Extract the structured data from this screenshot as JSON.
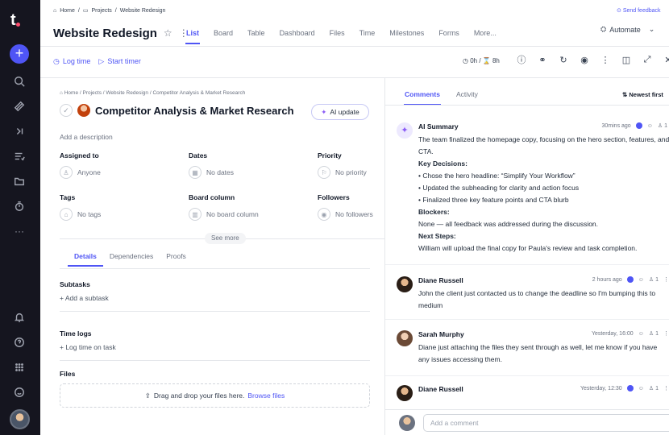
{
  "top": {
    "breadcrumb": [
      "Home",
      "Projects",
      "Website Redesign"
    ],
    "feedback": "Send feedback"
  },
  "project": {
    "title": "Website Redesign",
    "views": [
      "List",
      "Board",
      "Table",
      "Dashboard",
      "Files",
      "Time",
      "Milestones",
      "Forms",
      "More..."
    ],
    "active_view": "List",
    "automate": "Automate"
  },
  "toolbar": {
    "log_time": "Log time",
    "start_timer": "Start timer",
    "timer_status": "0h / ⌛ 8h"
  },
  "task": {
    "breadcrumb": "Home / Projects / Website Redesign / Competitor Analysis & Market Research",
    "title": "Competitor Analysis & Market Research",
    "ai_update": "AI update",
    "add_description": "Add a description",
    "fields": {
      "assigned_label": "Assigned to",
      "assigned_value": "Anyone",
      "dates_label": "Dates",
      "dates_value": "No dates",
      "priority_label": "Priority",
      "priority_value": "No priority",
      "tags_label": "Tags",
      "tags_value": "No tags",
      "column_label": "Board column",
      "column_value": "No board column",
      "followers_label": "Followers",
      "followers_value": "No followers"
    },
    "see_more": "See more",
    "tabs": [
      "Details",
      "Dependencies",
      "Proofs"
    ],
    "active_tab": "Details",
    "subtasks_title": "Subtasks",
    "add_subtask": "Add a subtask",
    "timelogs_title": "Time logs",
    "log_time_on_task": "Log time on task",
    "files_title": "Files",
    "drop_text": "Drag and drop your files here.",
    "browse": "Browse files"
  },
  "comments_panel": {
    "tabs": [
      "Comments",
      "Activity"
    ],
    "sort": "Newest first",
    "ai_summary": {
      "name": "AI Summary",
      "time": "30mins ago",
      "count": "1",
      "intro": "The team finalized the homepage copy, focusing on the hero section, features, and CTA.",
      "decisions_title": "Key Decisions:",
      "decisions": [
        "• Chose the hero headline: “Simplify Your Workflow”",
        "• Updated the subheading for clarity and action focus",
        "• Finalized three key feature points and CTA blurb"
      ],
      "blockers_title": "Blockers:",
      "blockers": "None — all feedback was addressed during the discussion.",
      "next_title": "Next Steps:",
      "next": "William will upload the final copy for Paula's review and task completion."
    },
    "comments": [
      {
        "name": "Diane Russell",
        "time": "2 hours ago",
        "count": "1",
        "text": "John the client just contacted us to change the deadline so I'm bumping this to medium"
      },
      {
        "name": "Sarah Murphy",
        "time": "Yesterday, 16:00",
        "count": "1",
        "text": "Diane just attaching the files they sent through as well, let me know if you have any issues accessing them."
      },
      {
        "name": "Diane Russell",
        "time": "Yesterday, 12:30",
        "count": "1",
        "text": ""
      }
    ],
    "add_comment_placeholder": "Add a comment"
  }
}
